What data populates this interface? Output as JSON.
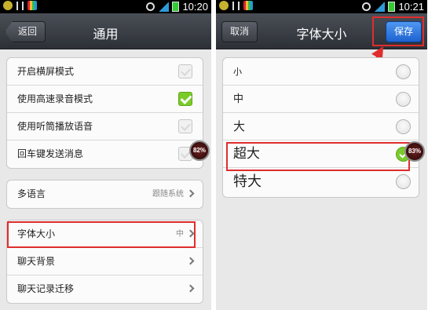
{
  "status_bar": {
    "left_time": "10:20",
    "right_time": "10:21"
  },
  "left_screen": {
    "header": {
      "back_label": "返回",
      "title": "通用"
    },
    "group1": {
      "items": [
        {
          "label": "开启横屏模式",
          "checked": false
        },
        {
          "label": "使用高速录音模式",
          "checked": true
        },
        {
          "label": "使用听筒播放语音",
          "checked": false
        },
        {
          "label": "回车键发送消息",
          "checked": false
        }
      ]
    },
    "group2": {
      "items": [
        {
          "label": "多语言",
          "value": "跟随系统"
        }
      ]
    },
    "group3": {
      "items": [
        {
          "label": "字体大小",
          "value": "中"
        },
        {
          "label": "聊天背景",
          "value": ""
        },
        {
          "label": "聊天记录迁移",
          "value": ""
        }
      ]
    },
    "badge": "82%"
  },
  "right_screen": {
    "header": {
      "cancel_label": "取消",
      "title": "字体大小",
      "save_label": "保存"
    },
    "options": [
      {
        "label": "小",
        "selected": false
      },
      {
        "label": "中",
        "selected": false
      },
      {
        "label": "大",
        "selected": false
      },
      {
        "label": "超大",
        "selected": true
      },
      {
        "label": "特大",
        "selected": false
      }
    ],
    "badge": "83%"
  },
  "colors": {
    "highlight": "#e02d2d",
    "check_green": "#7acb2a",
    "save_blue": "#1d62d0"
  }
}
